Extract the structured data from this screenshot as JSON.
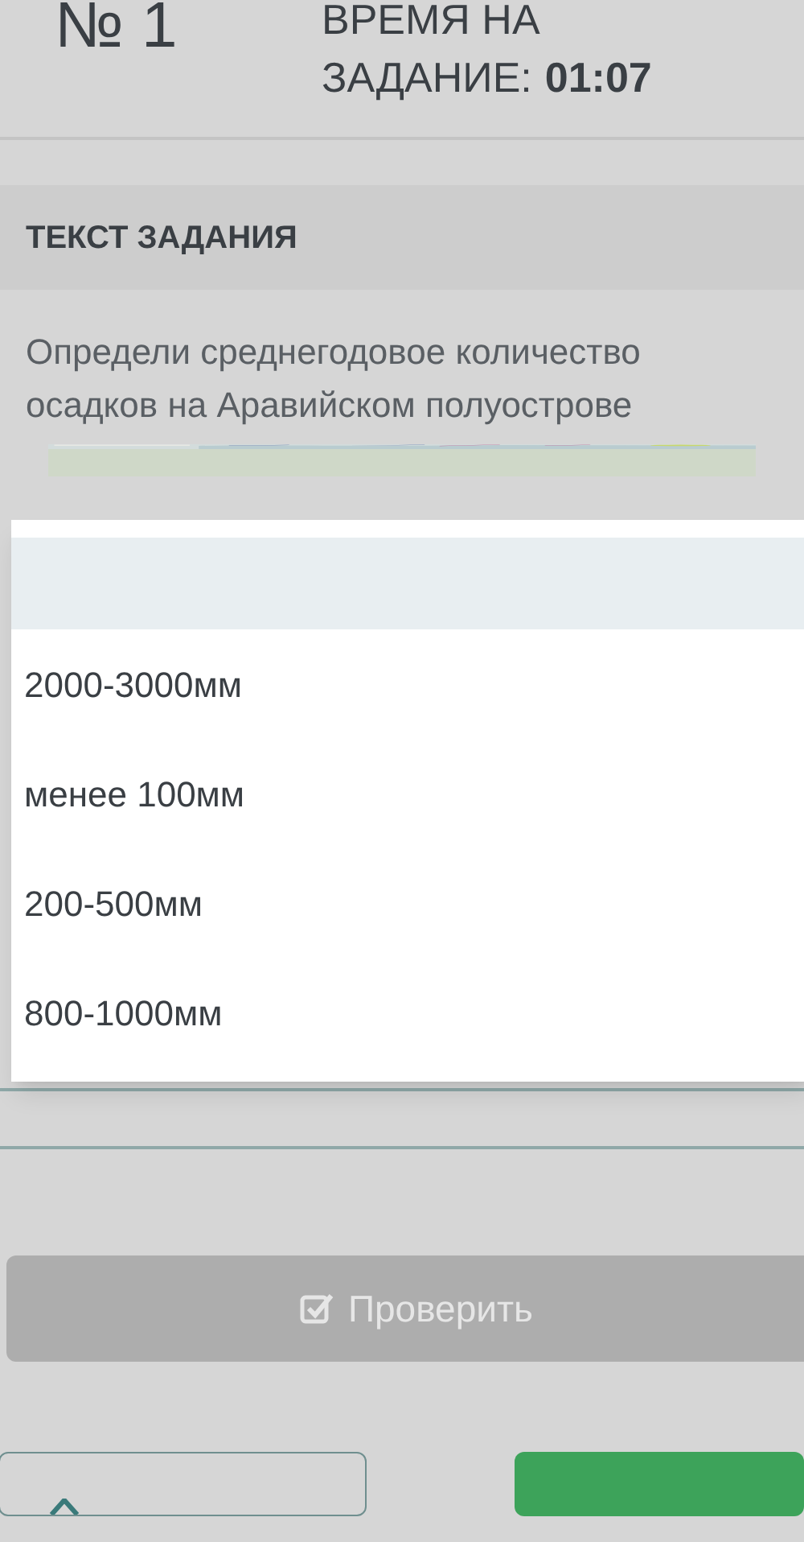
{
  "header": {
    "task_number": "№ 1",
    "timer_label_line1": "ВРЕМЯ НА",
    "timer_label_line2": "ЗАДАНИЕ:",
    "timer_value": "01:07"
  },
  "section": {
    "title": "ТЕКСТ ЗАДАНИЯ",
    "question": "Определи среднегодовое количество осадков на Аравийском полуострове"
  },
  "dropdown": {
    "options": [
      {
        "selected": true
      },
      {
        "label": "2000-3000мм",
        "selected": false
      },
      {
        "label": "менее 100мм",
        "selected": false
      },
      {
        "label": "200-500мм",
        "selected": false
      },
      {
        "label": "800-1000мм",
        "selected": false
      }
    ]
  },
  "check_button": {
    "label": "Проверить",
    "disabled": true
  }
}
